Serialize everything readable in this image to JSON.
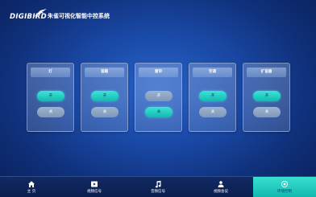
{
  "header": {
    "logo_text": "DIGIBIRD",
    "title": "朱雀可视化智能中控系统"
  },
  "panels": [
    {
      "title": "灯",
      "buttons": [
        {
          "label": "开",
          "active": true
        },
        {
          "label": "关",
          "active": false
        }
      ]
    },
    {
      "title": "音箱",
      "buttons": [
        {
          "label": "开",
          "active": true
        },
        {
          "label": "关",
          "active": false
        }
      ]
    },
    {
      "title": "窗帘",
      "buttons": [
        {
          "label": "开",
          "active": false
        },
        {
          "label": "关",
          "active": true
        }
      ]
    },
    {
      "title": "空调",
      "buttons": [
        {
          "label": "开",
          "active": true
        },
        {
          "label": "关",
          "active": false
        }
      ]
    },
    {
      "title": "扩音器",
      "buttons": [
        {
          "label": "开",
          "active": true
        },
        {
          "label": "关",
          "active": false
        }
      ]
    }
  ],
  "nav": {
    "items": [
      {
        "label": "主 页",
        "icon": "home-icon",
        "active": false
      },
      {
        "label": "视频信号",
        "icon": "video-signal-icon",
        "active": false
      },
      {
        "label": "音频信号",
        "icon": "music-note-icon",
        "active": false
      },
      {
        "label": "视频会议",
        "icon": "video-conference-icon",
        "active": false
      },
      {
        "label": "环境控制",
        "icon": "environment-control-icon",
        "active": true
      }
    ]
  },
  "colors": {
    "accent": "#1fc8be",
    "background": "#1a4aa8",
    "nav_background": "#0f2659",
    "inactive_button": "#8ea7c4"
  }
}
